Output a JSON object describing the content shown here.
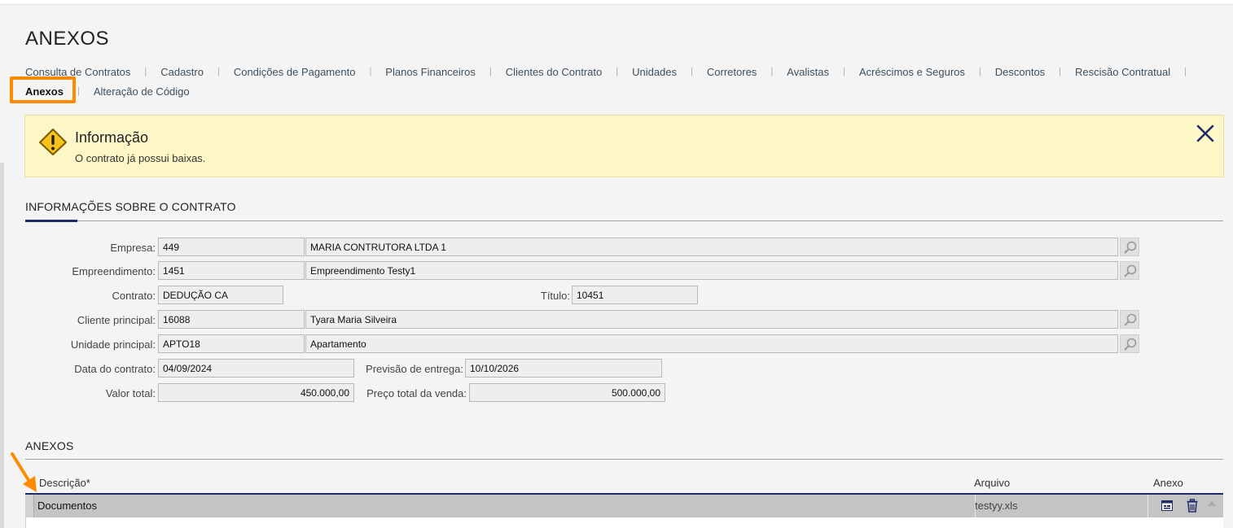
{
  "page": {
    "title": "ANEXOS"
  },
  "nav": {
    "row1": [
      "Consulta de Contratos",
      "Cadastro",
      "Condições de Pagamento",
      "Planos Financeiros",
      "Clientes do Contrato",
      "Unidades",
      "Corretores",
      "Avalistas",
      "Acréscimos e Seguros",
      "Descontos",
      "Rescisão Contratual"
    ],
    "row2": [
      "Anexos",
      "Alteração de Código"
    ],
    "separator": "|",
    "active": "Anexos"
  },
  "info": {
    "title": "Informação",
    "message": "O contrato já possui baixas."
  },
  "contract": {
    "section_title": "INFORMAÇÕES SOBRE O CONTRATO",
    "empresa": {
      "label": "Empresa:",
      "code": "449",
      "name": "MARIA CONTRUTORA LTDA 1"
    },
    "empreendimento": {
      "label": "Empreendimento:",
      "code": "1451",
      "name": "Empreendimento Testy1"
    },
    "contrato": {
      "label": "Contrato:",
      "value": "DEDUÇÃO CA"
    },
    "titulo": {
      "label": "Título:",
      "value": "10451"
    },
    "cliente": {
      "label": "Cliente principal:",
      "code": "16088",
      "name": "Tyara Maria Silveira"
    },
    "unidade": {
      "label": "Unidade principal:",
      "code": "APTO18",
      "name": "Apartamento"
    },
    "data_contrato": {
      "label": "Data do contrato:",
      "value": "04/09/2024"
    },
    "previsao_entrega": {
      "label": "Previsão de entrega:",
      "value": "10/10/2026"
    },
    "valor_total": {
      "label": "Valor total:",
      "value": "450.000,00"
    },
    "preco_total": {
      "label": "Preço total da venda:",
      "value": "500.000,00"
    }
  },
  "anexos": {
    "section_title": "ANEXOS",
    "columns": [
      "Descrição*",
      "Arquivo",
      "Anexo"
    ],
    "rows": [
      {
        "descricao": "Documentos",
        "arquivo": "testyy.xls"
      }
    ]
  },
  "colors": {
    "accent": "#1f2a6b",
    "highlight": "#ff8a00",
    "info_bg": "#fdf6c7"
  },
  "icons": {
    "warning": "warning-icon",
    "close": "close-icon",
    "lookup": "search-icon",
    "view": "view-attachment-icon",
    "delete": "trash-icon"
  }
}
